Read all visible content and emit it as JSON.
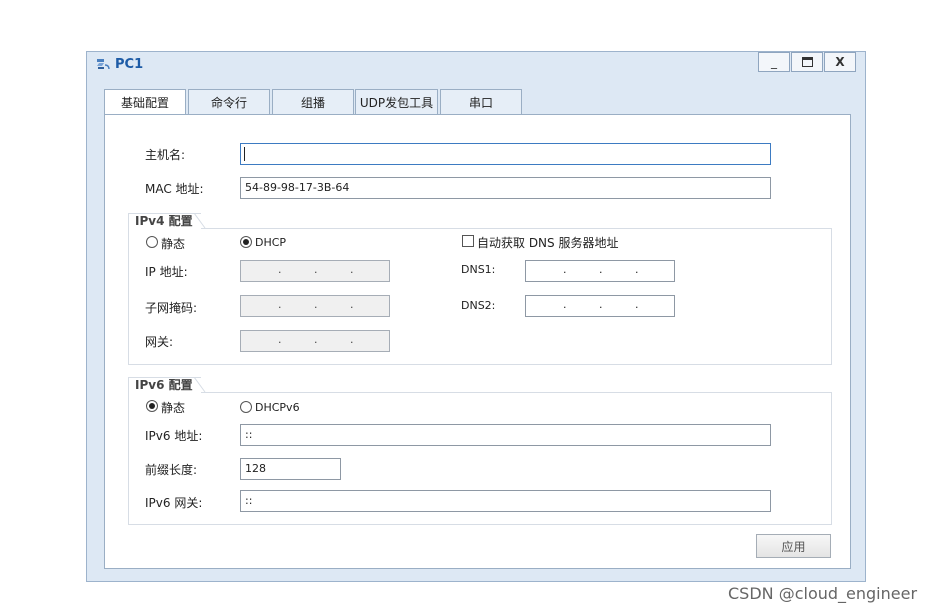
{
  "window": {
    "title": "PC1",
    "close_glyph": "X",
    "min_glyph": "_",
    "max_glyph": "▭"
  },
  "tabs": [
    {
      "label": "基础配置",
      "active": true
    },
    {
      "label": "命令行"
    },
    {
      "label": "组播"
    },
    {
      "label": "UDP发包工具"
    },
    {
      "label": "串口"
    }
  ],
  "basic": {
    "hostname_label": "主机名:",
    "hostname_value": "",
    "mac_label": "MAC 地址:",
    "mac_value": "54-89-98-17-3B-64"
  },
  "ipv4": {
    "group_title": "IPv4 配置",
    "static_label": "静态",
    "dhcp_label": "DHCP",
    "dhcp_selected": true,
    "auto_dns_label": "自动获取 DNS 服务器地址",
    "ip_label": "IP 地址:",
    "mask_label": "子网掩码:",
    "gateway_label": "网关:",
    "dns1_label": "DNS1:",
    "dns2_label": "DNS2:",
    "dot": "."
  },
  "ipv6": {
    "group_title": "IPv6 配置",
    "static_label": "静态",
    "dhcpv6_label": "DHCPv6",
    "static_selected": true,
    "addr_label": "IPv6 地址:",
    "addr_value": "::",
    "prefix_label": "前缀长度:",
    "prefix_value": "128",
    "gateway_label": "IPv6 网关:",
    "gateway_value": "::"
  },
  "apply_label": "应用",
  "watermark": "CSDN @cloud_engineer",
  "icons": [
    "app-network-icon",
    "minimize-icon",
    "maximize-icon",
    "close-icon"
  ]
}
